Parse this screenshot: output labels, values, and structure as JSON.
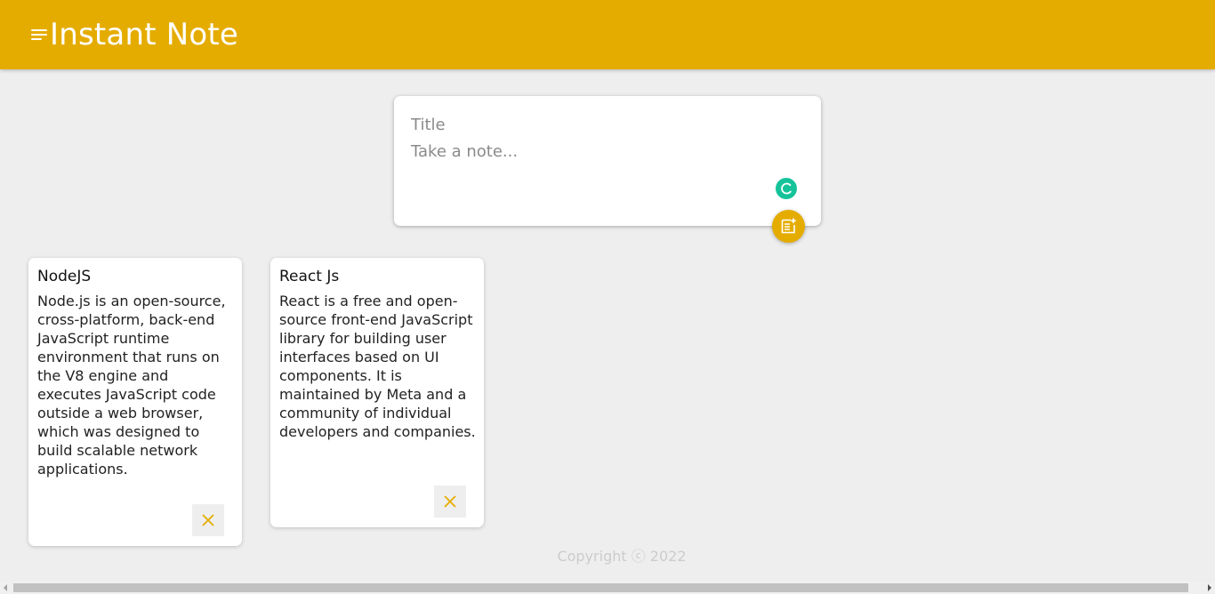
{
  "header": {
    "title": "Instant Note",
    "menu_icon": "menu-icon",
    "background_color": "#e5ac00"
  },
  "create_note": {
    "title_placeholder": "Title",
    "content_placeholder": "Take a note...",
    "grammar_icon": "grammarly-icon",
    "add_icon": "note-add-icon"
  },
  "notes": [
    {
      "title": "NodeJS",
      "content": "Node.js is an open-source, cross-platform, back-end JavaScript runtime environment that runs on the V8 engine and executes JavaScript code outside a web browser, which was designed to build scalable network applications.",
      "delete_icon": "close-icon"
    },
    {
      "title": "React Js",
      "content": "React is a free and open-source front-end JavaScript library for building user interfaces based on UI components. It is maintained by Meta and a community of individual developers and companies.",
      "delete_icon": "close-icon"
    }
  ],
  "footer": {
    "copyright": "Copyright ⓒ 2022"
  },
  "colors": {
    "accent": "#e5ac00",
    "grammarly": "#15c39a",
    "page_background": "#eeeeee"
  }
}
